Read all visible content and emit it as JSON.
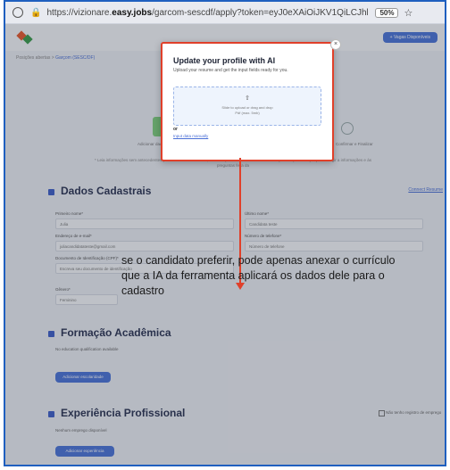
{
  "browser": {
    "url_prefix": "https://vizionare.",
    "url_domain": "easy.jobs",
    "url_rest": "/garcom-sescdf/apply?token=eyJ0eXAiOiJKV1QiLCJhbGciOiJSUzI1NiJ9...",
    "zoom": "50%"
  },
  "page": {
    "new_jobs_button": "+ Vagas Disponíveis",
    "breadcrumb_home": "Posições abertas",
    "breadcrumb_sep": ">",
    "breadcrumb_current": "Garçom (SESC/DF)",
    "step1_label": "Adicionar dados de candidato",
    "step2_label": "Confirmar e Finalizar",
    "steps_note": "* Leia informações sem antecedentes para recrutamento desta, mas nos precisa informar suas informações os pessoal que para redigir a informações e ás preguntas feita da",
    "section1_title": "Dados Cadastrais",
    "connect_resume": "Connect Resume",
    "first_name_label": "Primeiro nome*",
    "first_name_value": "Julia",
    "last_name_label": "Último nome*",
    "last_name_value": "Candidata teste",
    "email_label": "Endereço de e-mail*",
    "email_value": "juliacandidatateste@gmail.com",
    "phone_label": "Número de telefone*",
    "phone_placeholder": "Número de telefone",
    "doc_label": "Documento de Identificação (CPF)*",
    "doc_placeholder": "Escreva seu documento de identificação",
    "gender_label": "Gênero*",
    "gender_value": "Feminino",
    "section2_title": "Formação Acadêmica",
    "no_education": "No education qualification available",
    "add_education_button": "Adicionar escolaridade",
    "section3_title": "Experiência Profissional",
    "no_employment": "Nenhum emprego disponível",
    "no_employment_check": "Não tenho registro de emprego",
    "add_experience_button": "Adicionar experiência"
  },
  "modal": {
    "title": "Update your profile with AI",
    "subtitle": "Upload your resume and get the input fields ready for you.",
    "upload_icon": "upload-icon",
    "drop_text1": "Slide to upload or drag and drop",
    "drop_text2": "Pdf (max. 5mb)",
    "or_label": "or",
    "manual_link": "Input data manually",
    "close_symbol": "×"
  },
  "annotation": {
    "text": "se o candidato preferir, pode apenas anexar o currículo que a IA da ferramenta aplicará os dados dele para o cadastro"
  },
  "colors": {
    "highlight": "#e0402a",
    "accent": "#4a73d9"
  }
}
